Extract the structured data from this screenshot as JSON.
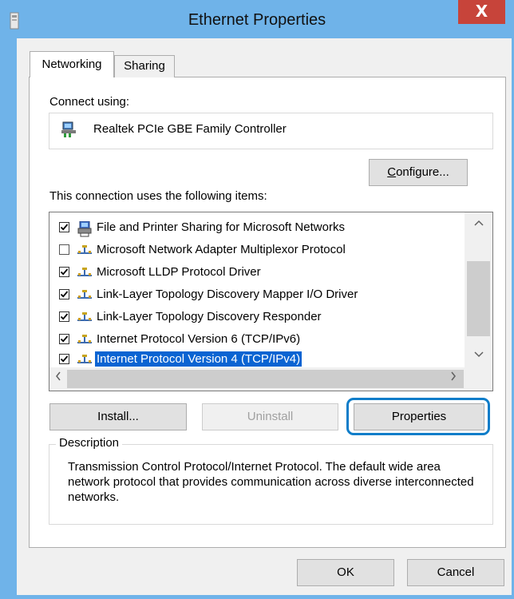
{
  "window": {
    "title": "Ethernet Properties",
    "close_label": "X"
  },
  "tabs": [
    {
      "label": "Networking",
      "active": true
    },
    {
      "label": "Sharing",
      "active": false
    }
  ],
  "connect": {
    "label": "Connect using:",
    "adapter": "Realtek PCIe GBE Family Controller",
    "configure_pre": "",
    "configure_key": "C",
    "configure_post": "onfigure..."
  },
  "items_label": "This connection uses the following items:",
  "items": [
    {
      "label": "File and Printer Sharing for Microsoft Networks",
      "checked": true,
      "icon": "printer-share-icon"
    },
    {
      "label": "Microsoft Network Adapter Multiplexor Protocol",
      "checked": false,
      "icon": "network-protocol-icon"
    },
    {
      "label": "Microsoft LLDP Protocol Driver",
      "checked": true,
      "icon": "network-protocol-icon"
    },
    {
      "label": "Link-Layer Topology Discovery Mapper I/O Driver",
      "checked": true,
      "icon": "network-protocol-icon"
    },
    {
      "label": "Link-Layer Topology Discovery Responder",
      "checked": true,
      "icon": "network-protocol-icon"
    },
    {
      "label": "Internet Protocol Version 6 (TCP/IPv6)",
      "checked": true,
      "icon": "network-protocol-icon"
    },
    {
      "label": "Internet Protocol Version 4 (TCP/IPv4)",
      "checked": true,
      "icon": "network-protocol-icon",
      "selected": true
    }
  ],
  "buttons": {
    "install": "Install...",
    "uninstall": "Uninstall",
    "properties": "Properties",
    "ok": "OK",
    "cancel": "Cancel"
  },
  "description": {
    "label": "Description",
    "text": "Transmission Control Protocol/Internet Protocol. The default wide area network protocol that provides communication across diverse interconnected networks."
  },
  "colors": {
    "titlebar": "#6fb3e9",
    "close": "#c7443a",
    "selection": "#0a64d2",
    "highlight": "#0f7dc9"
  }
}
